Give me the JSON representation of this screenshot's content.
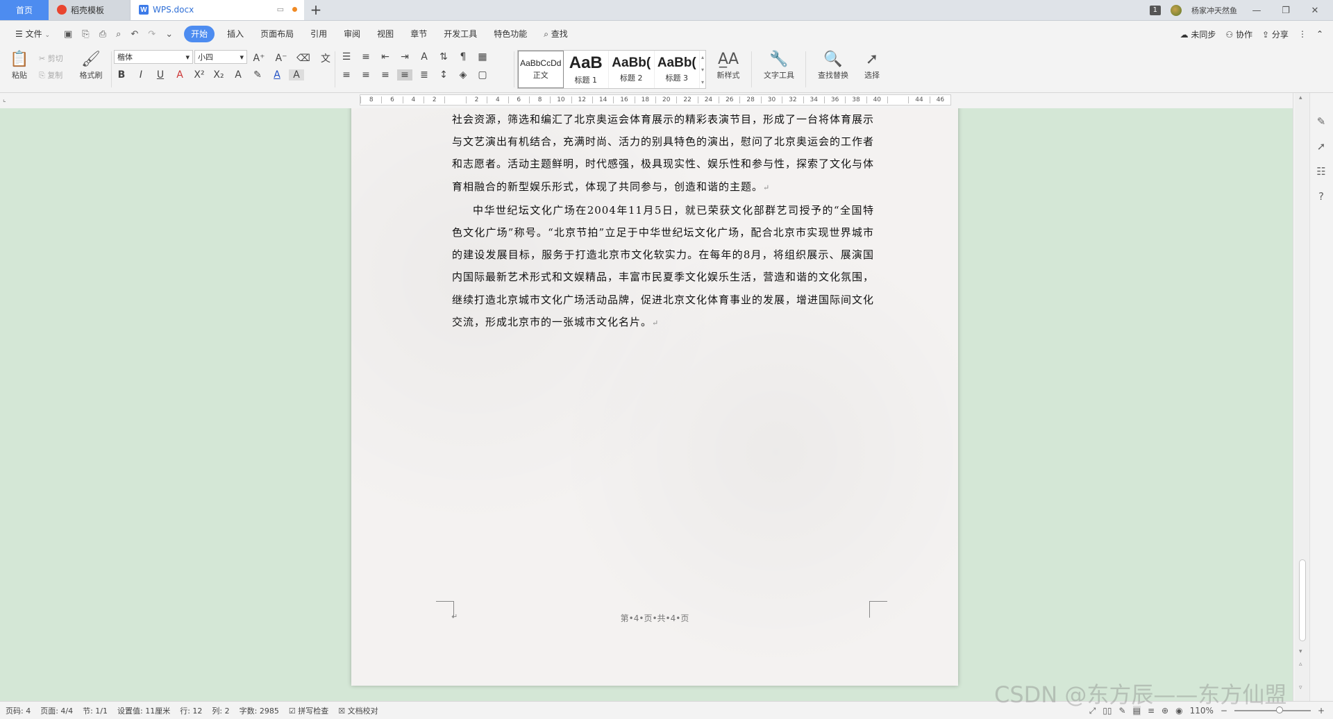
{
  "tabs": {
    "home": "首页",
    "template": "稻壳模板",
    "doc": "WPS.docx",
    "doc_icon": "W",
    "new_tab": "+"
  },
  "titlebar": {
    "window_count": "1",
    "username": "杨家冲天然鱼"
  },
  "menubar": {
    "file": "文件",
    "items": [
      "开始",
      "插入",
      "页面布局",
      "引用",
      "审阅",
      "视图",
      "章节",
      "开发工具",
      "特色功能"
    ],
    "search": "查找",
    "sync": "未同步",
    "collab": "协作",
    "share": "分享"
  },
  "ribbon": {
    "paste": "粘贴",
    "cut": "剪切",
    "copy": "复制",
    "format_painter": "格式刷",
    "font_name": "楷体",
    "font_size": "小四",
    "styles": [
      {
        "sample": "AaBbCcDd",
        "name": "正文"
      },
      {
        "sample": "AaB",
        "name": "标题 1"
      },
      {
        "sample": "AaBb(",
        "name": "标题 2"
      },
      {
        "sample": "AaBb(",
        "name": "标题 3"
      }
    ],
    "new_style": "新样式",
    "text_tools": "文字工具",
    "find_replace": "查找替换",
    "select": "选择"
  },
  "ruler": {
    "ticks": [
      "8",
      "6",
      "4",
      "2",
      "",
      "2",
      "4",
      "6",
      "8",
      "10",
      "12",
      "14",
      "16",
      "18",
      "20",
      "22",
      "24",
      "26",
      "28",
      "30",
      "32",
      "34",
      "36",
      "38",
      "40",
      "",
      "44",
      "46"
    ]
  },
  "document": {
    "para1": "社会资源，筛选和编汇了北京奥运会体育展示的精彩表演节目，形成了一台将体育展示与文艺演出有机结合，充满时尚、活力的别具特色的演出，慰问了北京奥运会的工作者和志愿者。活动主题鲜明，时代感强，极具现实性、娱乐性和参与性，探索了文化与体育相融合的新型娱乐形式，体现了共同参与，创造和谐的主题。",
    "para2": "中华世纪坛文化广场在2004年11月5日，就已荣获文化部群艺司授予的“全国特色文化广场”称号。“北京节拍”立足于中华世纪坛文化广场，配合北京市实现世界城市的建设发展目标，服务于打造北京市文化软实力。在每年的8月，将组织展示、展演国内国际最新艺术形式和文娱精品，丰富市民夏季文化娱乐生活，营造和谐的文化氛围，继续打造北京城市文化广场活动品牌，促进北京文化体育事业的发展，增进国际间文化交流，形成北京市的一张城市文化名片。",
    "return_mark": "↵",
    "footer": "第•4•页•共•4•页"
  },
  "statusbar": {
    "page_code": "页码: 4",
    "pages": "页面: 4/4",
    "section": "节: 1/1",
    "setting": "设置值: 11厘米",
    "row": "行: 12",
    "col": "列: 2",
    "word_count": "字数: 2985",
    "spell_check": "拼写检查",
    "doc_proof": "文档校对",
    "zoom": "110%"
  },
  "watermark": "CSDN @东方辰——东方仙盟",
  "colors": {
    "accent": "#4d8cf0",
    "workspace": "#d4e7d6",
    "page": "#f4f2f1"
  }
}
